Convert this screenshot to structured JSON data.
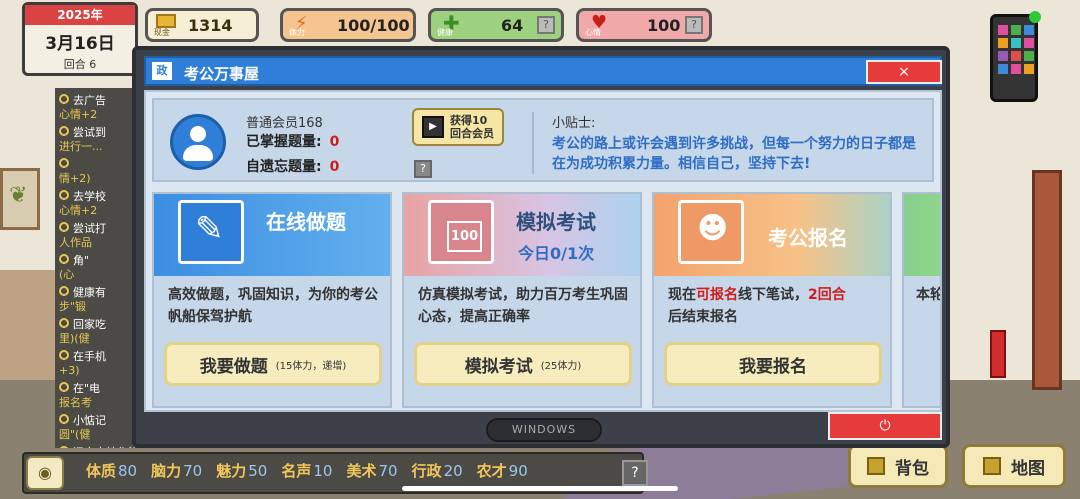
{
  "hud": {
    "date": {
      "year": "2025年",
      "day": "3月16日",
      "round": "回合 6"
    },
    "cash": {
      "value": "1314",
      "label": "现金",
      "icon": "coin-icon"
    },
    "power": {
      "value": "100/100",
      "label": "体力",
      "icon": "lightning-icon",
      "color": "#e56a17"
    },
    "health": {
      "value": "64",
      "label": "健康",
      "icon": "plus-icon",
      "color": "#3a8f2b"
    },
    "mood": {
      "value": "100",
      "label": "心情",
      "icon": "heart-icon",
      "color": "#c81d1d"
    },
    "help_label": "?"
  },
  "tasks": [
    {
      "text": "去广告",
      "sub": "心情+2"
    },
    {
      "text": "尝试到",
      "sub": "进行一..."
    },
    {
      "text": "",
      "sub": "情+2)"
    },
    {
      "text": "去学校",
      "sub": "心情+2"
    },
    {
      "text": "尝试打",
      "sub": "人作品"
    },
    {
      "text": "角\"",
      "sub": "(心"
    },
    {
      "text": "健康有",
      "sub": "步\"锻"
    },
    {
      "text": "回家吃",
      "sub": "里)(健"
    },
    {
      "text": "在手机",
      "sub": "+3)"
    },
    {
      "text": "在\"电",
      "sub": "报名考"
    },
    {
      "text": "小惦记",
      "sub": "圆\"(健"
    },
    {
      "text": "旧宅土地作物待维护",
      "sub": ""
    }
  ],
  "window": {
    "logo": "政",
    "title": "考公万事屋",
    "close_label": "×",
    "member": {
      "name": "普通会员168",
      "mastered_label": "已掌握题量:",
      "mastered_value": "0",
      "forgotten_label": "自遗忘题量:",
      "forgotten_value": "0",
      "vip_line1": "获得10",
      "vip_line2": "回合会员",
      "help": "?"
    },
    "tip": {
      "title": "小贴士:",
      "text": "考公的路上或许会遇到许多挑战，但每一个努力的日子都是在为成功积累力量。相信自己，坚持下去!"
    },
    "cards": [
      {
        "title": "在线做题",
        "subtitle": "",
        "desc": "高效做题，巩固知识，为你的考公帆船保驾护航",
        "button": "我要做题",
        "button_note": "(15体力，递增)",
        "icon": "pencil-icon"
      },
      {
        "title": "模拟考试",
        "subtitle": "今日0/1次",
        "desc": "仿真模拟考试，助力百万考生巩固心态，提高正确率",
        "button": "模拟考试",
        "button_note": "(25体力)",
        "icon": "exam-paper-icon"
      },
      {
        "title": "考公报名",
        "subtitle": "",
        "desc_pre": "现在",
        "desc_hl": "可报名",
        "desc_mid": "线下笔试，",
        "desc_hl2": "2回合",
        "desc_post": "后结束报名",
        "button": "我要报名",
        "button_note": "",
        "icon": "id-card-icon"
      },
      {
        "title": "",
        "desc": "本轮",
        "icon": "book-icon"
      }
    ],
    "taskbar_label": "WINDOWS",
    "power_label": "⏻"
  },
  "bottom": {
    "attrs": [
      {
        "k": "体质",
        "v": "80"
      },
      {
        "k": "脑力",
        "v": "70"
      },
      {
        "k": "魅力",
        "v": "50"
      },
      {
        "k": "名声",
        "v": "10"
      },
      {
        "k": "美术",
        "v": "70"
      },
      {
        "k": "行政",
        "v": "20"
      },
      {
        "k": "农才",
        "v": "90"
      }
    ],
    "help": "?",
    "bag_label": "背包",
    "map_label": "地图",
    "eye_icon": "eye-icon"
  }
}
